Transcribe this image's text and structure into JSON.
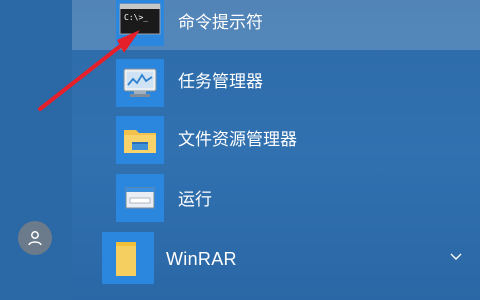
{
  "start_menu": {
    "items": [
      {
        "label": "命令提示符",
        "icon": "cmd-icon",
        "highlighted": true
      },
      {
        "label": "任务管理器",
        "icon": "task-manager-icon"
      },
      {
        "label": "文件资源管理器",
        "icon": "folder-icon"
      },
      {
        "label": "运行",
        "icon": "run-icon"
      }
    ],
    "group": {
      "label": "WinRAR",
      "icon": "folder-yellow-icon",
      "expand_icon": "chevron-down-icon"
    },
    "user_icon": "user-avatar-icon"
  },
  "annotation": {
    "arrow_color": "#e5202a"
  },
  "colors": {
    "background": "#2d6aa8",
    "tile": "#2b87dd",
    "highlight": "rgba(255,255,255,0.18)"
  }
}
